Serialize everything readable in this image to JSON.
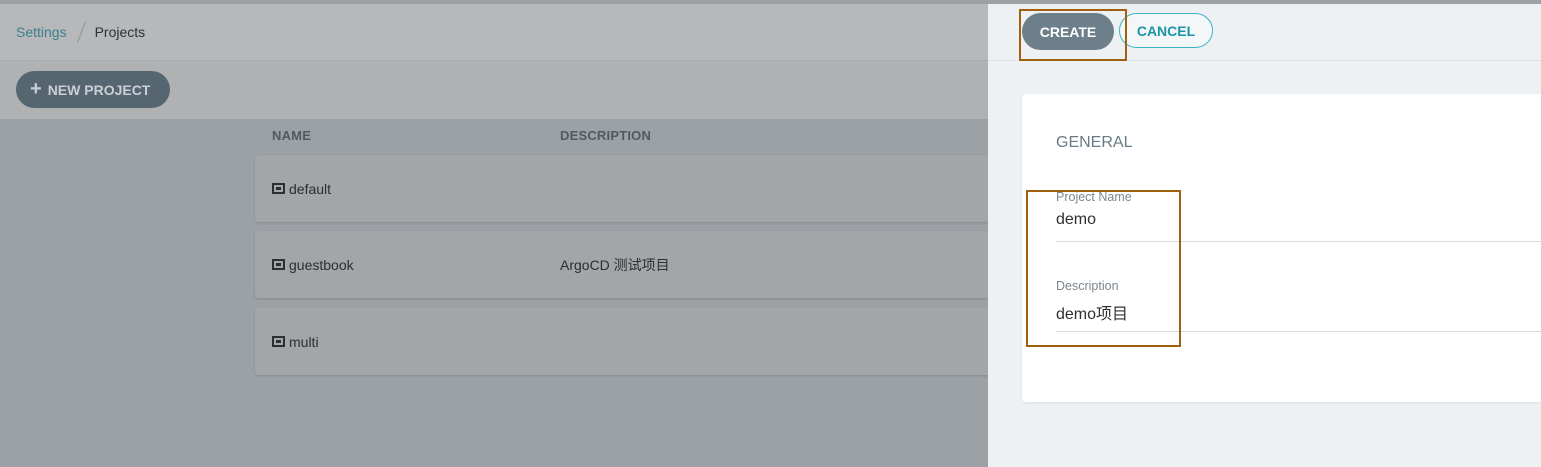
{
  "breadcrumb": {
    "parent": "Settings",
    "current": "Projects"
  },
  "toolbar": {
    "new_project_label": "NEW PROJECT"
  },
  "table": {
    "columns": [
      "NAME",
      "DESCRIPTION"
    ],
    "rows": [
      {
        "name": "default",
        "description": ""
      },
      {
        "name": "guestbook",
        "description": "ArgoCD 测试项目"
      },
      {
        "name": "multi",
        "description": ""
      }
    ]
  },
  "panel": {
    "create_label": "CREATE",
    "cancel_label": "CANCEL",
    "section_title": "GENERAL",
    "fields": [
      {
        "label": "Project Name",
        "value": "demo"
      },
      {
        "label": "Description",
        "value": "demo项目"
      }
    ]
  },
  "colors": {
    "highlight": "#a0600d",
    "accent": "#1c93a8",
    "primary_button": "#6d7f8b"
  }
}
